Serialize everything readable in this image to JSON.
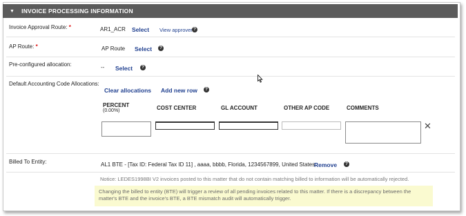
{
  "section": {
    "title": "INVOICE PROCESSING INFORMATION"
  },
  "approval": {
    "label": "Invoice Approval Route:",
    "value": "AR1_ACR",
    "select": "Select",
    "view": "View approvers"
  },
  "ap_route": {
    "label": "AP Route:",
    "value": "AP Route",
    "select": "Select"
  },
  "preconfig": {
    "label": "Pre-configured allocation:",
    "value": "--",
    "select": "Select"
  },
  "allocations": {
    "label": "Default Accounting Code Allocations:",
    "clear": "Clear allocations",
    "add_row": "Add new row",
    "columns": {
      "percent": "PERCENT",
      "percent_sub": "(0.00%)",
      "cost_center": "COST CENTER",
      "gl_account": "GL ACCOUNT",
      "other_ap": "OTHER AP CODE",
      "comments": "COMMENTS"
    }
  },
  "billed": {
    "label": "Billed To Entity:",
    "value": "AL1 BTE - [Tax ID: Federal Tax ID 11] , aaaa, bbbb, Florida, 1234567899, United States",
    "remove": "Remove"
  },
  "notice": "Notice: LEDES1998BI V2 invoices posted to this matter that do not contain matching billed to information will be automatically rejected.",
  "warning": "Changing the billed to entity (BTE) will trigger a review of all pending invoices related to this matter. If there is a discrepancy between the matter's BTE and the invoice's BTE, a BTE mismatch audit will automatically trigger.",
  "colors": {
    "header_bg": "#5b5b5b",
    "link": "#1f3f8f",
    "required": "#dd1111",
    "warning_bg": "#fafad0"
  }
}
